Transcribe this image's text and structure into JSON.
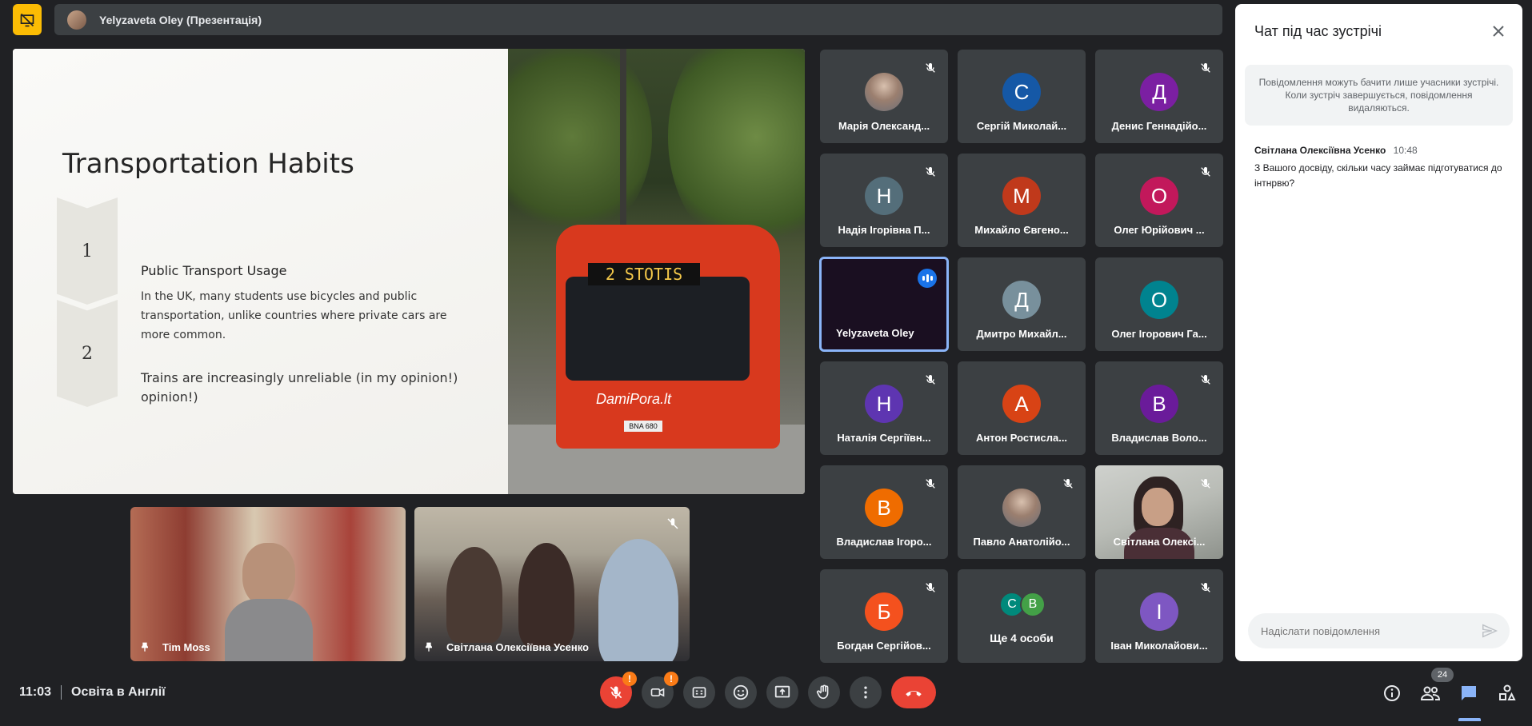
{
  "presentation": {
    "bar_text": "Yelyzaveta Oley (Презентація)"
  },
  "slide": {
    "title": "Transportation Habits",
    "items": [
      {
        "number": "1",
        "heading": "Public Transport Usage",
        "body": "In the UK, many students use bicycles and public transportation, unlike countries where private cars are more common."
      },
      {
        "number": "2",
        "heading": "Trains are increasingly unreliable (in my opinion!) opinion!)"
      }
    ],
    "photo": {
      "sign": "2 STOTIS",
      "brand": "DamiPora.lt",
      "plate": "BNA 680"
    }
  },
  "pinned": [
    {
      "name": "Tim Moss"
    },
    {
      "name": "Світлана Олексіївна Усенко"
    }
  ],
  "participants": [
    {
      "name": "Марія Олександ...",
      "initial": "",
      "color": "#8d6e63",
      "muted": true,
      "photo": true
    },
    {
      "name": "Сергій Миколай...",
      "initial": "С",
      "color": "#1558a6",
      "muted": false
    },
    {
      "name": "Денис Геннадійо...",
      "initial": "Д",
      "color": "#7b1fa2",
      "muted": true
    },
    {
      "name": "Надія Ігорівна П...",
      "initial": "Н",
      "color": "#546e7a",
      "muted": true
    },
    {
      "name": "Михайло Євгено...",
      "initial": "М",
      "color": "#c0391b",
      "muted": false
    },
    {
      "name": "Олег Юрійович ...",
      "initial": "О",
      "color": "#c2185b",
      "muted": true
    },
    {
      "name": "Yelyzaveta Oley",
      "initial": "",
      "color": "",
      "muted": false,
      "active": true
    },
    {
      "name": "Дмитро Михайл...",
      "initial": "Д",
      "color": "#78909c",
      "muted": false
    },
    {
      "name": "Олег Ігорович Га...",
      "initial": "О",
      "color": "#00838f",
      "muted": false
    },
    {
      "name": "Наталія Сергіївн...",
      "initial": "Н",
      "color": "#5e35b1",
      "muted": true
    },
    {
      "name": "Антон Ростисла...",
      "initial": "А",
      "color": "#d84315",
      "muted": false
    },
    {
      "name": "Владислав Воло...",
      "initial": "В",
      "color": "#6a1b9a",
      "muted": true
    },
    {
      "name": "Владислав Ігоро...",
      "initial": "В",
      "color": "#ef6c00",
      "muted": true
    },
    {
      "name": "Павло Анатолійо...",
      "initial": "",
      "color": "#9e9e9e",
      "muted": true,
      "photo": true
    },
    {
      "name": "Світлана Олексі...",
      "initial": "",
      "color": "",
      "muted": true,
      "video": true
    },
    {
      "name": "Богдан Сергійов...",
      "initial": "Б",
      "color": "#f4511e",
      "muted": true
    },
    {
      "name": "Ще 4 особи",
      "initial": "",
      "color": "",
      "muted": false,
      "more": true,
      "mini": [
        "С",
        "В"
      ]
    },
    {
      "name": "Іван Миколайови...",
      "initial": "І",
      "color": "#7e57c2",
      "muted": true
    }
  ],
  "chat": {
    "title": "Чат під час зустрічі",
    "notice": "Повідомлення можуть бачити лише учасники зустрічі. Коли зустріч завершується, повідомлення видаляються.",
    "messages": [
      {
        "author": "Світлана Олексіївна Усенко",
        "time": "10:48",
        "text": "З Вашого досвіду, скільки часу  займає підготуватися до інтнрвю?"
      }
    ],
    "input_placeholder": "Надіслати повідомлення"
  },
  "bottom": {
    "time": "11:03",
    "meeting": "Освіта в Англії",
    "mic_badge": "!",
    "cam_badge": "!",
    "people_count": "24"
  },
  "icons": {
    "present": "presentation-off-icon",
    "mic": "mic-off-icon",
    "camera": "camera-off-icon",
    "captions": "captions-icon",
    "emoji": "emoji-icon",
    "share": "present-screen-icon",
    "hand": "raise-hand-icon",
    "more": "more-vert-icon",
    "hangup": "hangup-icon",
    "info": "info-icon",
    "people": "people-icon",
    "chat": "chat-icon",
    "activities": "activities-icon"
  },
  "colors": {
    "accent": "#8ab4f8",
    "danger": "#ea4335",
    "warning": "#fa7b17",
    "present": "#fbbc04"
  }
}
